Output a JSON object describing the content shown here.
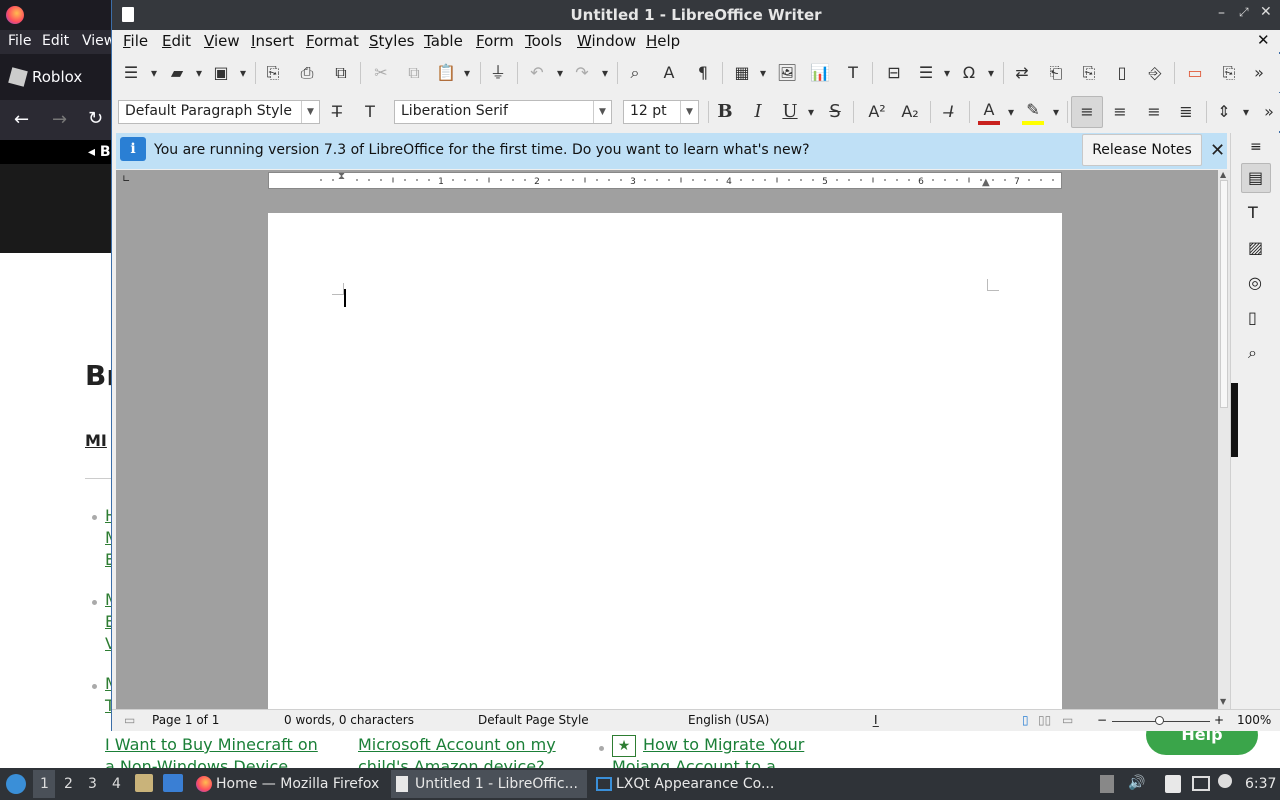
{
  "firefox": {
    "menu": [
      "File",
      "Edit",
      "View"
    ],
    "tab_title": "Roblox",
    "breadcrumb_back": "B",
    "heading_fragment": "Br",
    "subheading_fragment": "MI",
    "list_letters": [
      "H",
      "M",
      "E",
      "M",
      "E",
      "V",
      "M",
      "T"
    ],
    "footer_links": {
      "col1": [
        "I Want to Buy Minecraft on",
        "a Non-Windows Device"
      ],
      "col2": [
        "Microsoft Account on my",
        "child's Amazon device?"
      ],
      "col3": [
        "How to Migrate Your",
        "Mojang Account to a"
      ]
    },
    "help_button": "Help"
  },
  "writer": {
    "title": "Untitled 1 - LibreOffice Writer",
    "menu": [
      {
        "label": "File",
        "u": "F",
        "rest": "ile"
      },
      {
        "label": "Edit",
        "u": "E",
        "rest": "dit"
      },
      {
        "label": "View",
        "u": "V",
        "rest": "iew"
      },
      {
        "label": "Insert",
        "u": "I",
        "rest": "nsert"
      },
      {
        "label": "Format",
        "u": "F",
        "rest": "ormat"
      },
      {
        "label": "Styles",
        "u": "S",
        "rest": "tyles"
      },
      {
        "label": "Table",
        "u": "T",
        "rest": "able"
      },
      {
        "label": "Form",
        "u": "F",
        "rest": "orm"
      },
      {
        "label": "Tools",
        "u": "T",
        "rest": "ools"
      },
      {
        "label": "Window",
        "u": "W",
        "rest": "indow"
      },
      {
        "label": "Help",
        "u": "H",
        "rest": "elp"
      }
    ],
    "paragraph_style": "Default Paragraph Style",
    "font_name": "Liberation Serif",
    "font_size": "12 pt",
    "infobar_message": "You are running version 7.3 of LibreOffice for the first time. Do you want to learn what's new?",
    "release_notes_button": "Release Notes",
    "ruler_numbers": [
      "1",
      "2",
      "3",
      "4",
      "5",
      "6",
      "7"
    ],
    "status": {
      "page": "Page 1 of 1",
      "words": "0 words, 0 characters",
      "page_style": "Default Page Style",
      "language": "English (USA)",
      "zoom": "100%"
    },
    "colors": {
      "font_color": "#c9211e",
      "highlight": "#ffff00",
      "titlebar": "#35383d",
      "infobar": "#bfe0f6"
    }
  },
  "taskbar": {
    "workspaces": [
      "1",
      "2",
      "3",
      "4"
    ],
    "tasks": [
      {
        "label": "Home — Mozilla Firefox",
        "icon": "firefox-icon"
      },
      {
        "label": "Untitled 1 - LibreOffic...",
        "icon": "writer-icon"
      },
      {
        "label": "LXQt Appearance Co...",
        "icon": "settings-icon"
      }
    ],
    "clock": "6:37"
  }
}
